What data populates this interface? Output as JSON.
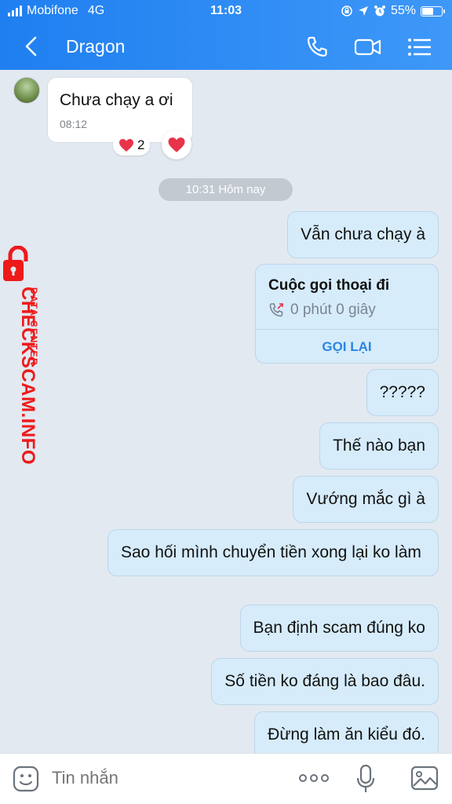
{
  "status_bar": {
    "carrier": "Mobifone",
    "network": "4G",
    "time": "11:03",
    "battery": "55%",
    "battery_fraction": 0.55
  },
  "header": {
    "contact_name": "Dragon"
  },
  "incoming": {
    "text": "Chưa chạy a ơi",
    "timestamp": "08:12",
    "reaction_count": "2"
  },
  "date_divider": "10:31 Hôm nay",
  "outgoing": {
    "m1": "Vẫn chưa chạy à",
    "m2": "?????",
    "m3": "Thế nào bạn",
    "m4": "Vướng mắc gì à",
    "m5": "Sao hối mình chuyển tiền xong lại ko làm",
    "m6": "Bạn định scam đúng ko",
    "m7": "Số tiền ko đáng là bao đâu.",
    "m8": "Đừng làm ăn kiểu đó."
  },
  "call_card": {
    "title": "Cuộc gọi thoại đi",
    "duration": "0 phút 0 giây",
    "recall_label": "GỌI LẠI"
  },
  "watermark": {
    "brand": "CHECKSCAM.INFO",
    "sub": "DATA CENTER"
  },
  "input": {
    "placeholder": "Tin nhắn"
  },
  "colors": {
    "header": "#2b8af3",
    "outgoing_bubble": "#d6ecfb",
    "accent": "#2b86e2",
    "watermark": "#ee1a1a",
    "chat_bg": "#e2e9f1"
  }
}
